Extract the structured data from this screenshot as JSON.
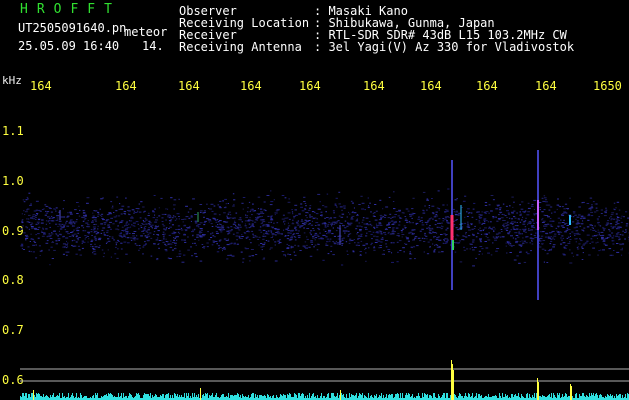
{
  "brand": "HROFFT",
  "file_name": "UT2505091640.pn",
  "tag": "meteor",
  "timestamp": "25.05.09 16:40",
  "count": "14.",
  "info": {
    "labels": [
      "Observer",
      "Receiving Location",
      "Receiver",
      "Receiving Antenna"
    ],
    "values": [
      ": Masaki Kano",
      ": Shibukawa, Gunma, Japan",
      ": RTL-SDR SDR# 43dB L15 103.2MHz CW",
      ": 3el Yagi(V) Az 330 for Vladivostok"
    ]
  },
  "x_axis": {
    "unit": "kHz",
    "ticks": [
      "164",
      "164",
      "164",
      "164",
      "164",
      "164",
      "164",
      "164",
      "164",
      "1650"
    ]
  },
  "y_axis": {
    "ticks": [
      "1.1",
      "1.0",
      "0.9",
      "0.8",
      "0.7",
      "0.6"
    ]
  },
  "colors": {
    "background": "#000000",
    "spectrogram_noise": "#1a1a6a",
    "text_yellow": "#ffff40",
    "brand_green": "#30e030",
    "trace_cyan": "#30e0e0"
  }
}
